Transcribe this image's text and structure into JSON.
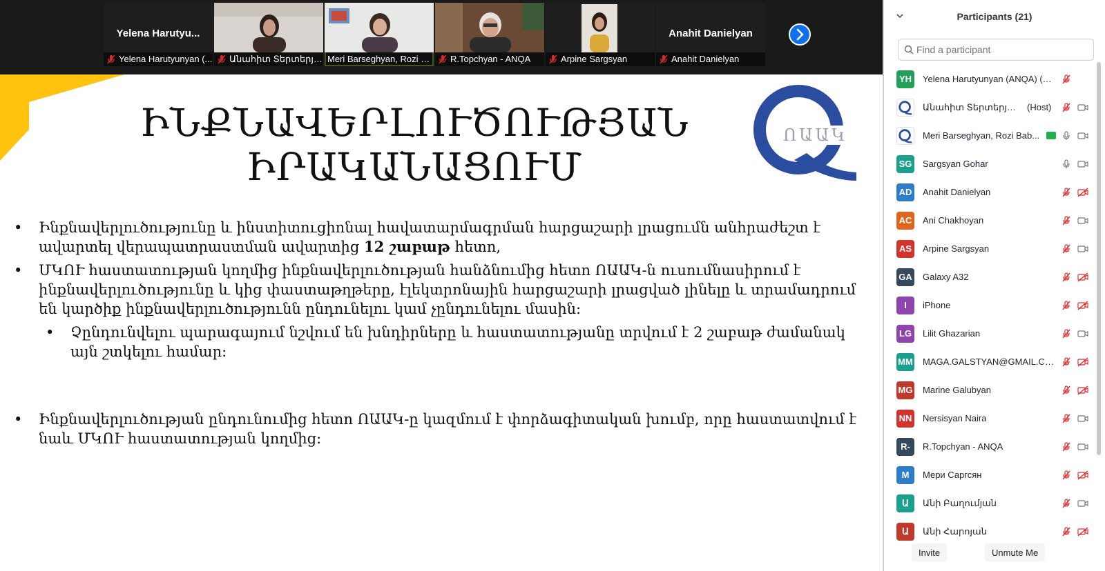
{
  "video_strip": {
    "tiles": [
      {
        "big_name": "Yelena  Harutyu...",
        "caption": "Yelena Harutyunyan (..."
      },
      {
        "caption": "Անահիտ Տերտերյա..."
      },
      {
        "caption": "Meri Barseghyan, Rozi B..."
      },
      {
        "caption": "R.Topchyan - ANQA"
      },
      {
        "caption": "Arpine Sargsyan"
      },
      {
        "big_name": "Anahit Danielyan",
        "caption": "Anahit Danielyan"
      }
    ],
    "next_icon": "chevron-right-icon"
  },
  "slide": {
    "title_line1": "ԻՆՔՆԱՎԵՐԼՈՒԾՈՒԹՅԱՆ",
    "title_line2": "ԻՐԱԿԱՆԱՑՈՒՄ",
    "logo_text": "ՈԱԱԿ",
    "bullet1_part1": "Ինքնավերլուծությունը և ինստիտուցիոնալ հավատարմագրման հարցաշարի լրացումն անհրաժեշտ է ավարտել վերապատրաստման ավարտից",
    "bullet1_bold": "12 շաբաթ",
    "bullet1_part2": "հետո,",
    "bullet2": "ՄԿՈՒ հաստատության կողմից ինքնավերլուծության հանձնումից հետո ՈԱԱԿ-ն ուսումնասիրում է ինքնավերլուծությունը և կից փաստաթղթերը, էլեկտրոնային հարցաշարի լրացված լինելը և տրամադրում են կարծիք ինքնավերլուծությունն ընդունելու կամ չընդունելու մասին:",
    "sub_bullet": "Չընդունվելու պարագայում նշվում են խնդիրները և հաստատությանը տրվում է 2 շաբաթ ժամանակ այն շտկելու համար:",
    "bullet3": "Ինքնավերլուծության ընդունումից հետո ՈԱԱԿ-ը կազմում է փորձագիտական խումբ, որը հաստատվում է նաև ՄԿՈՒ հաստատության կողմից:",
    "bullet_glyph": "•",
    "accent_color": "#FFC20E",
    "logo_color": "#2B4DA0"
  },
  "participants": {
    "title": "Participants (21)",
    "search_placeholder": "Find a participant",
    "items": [
      {
        "initials": "YH",
        "name": "Yelena Harutyunyan (ANQA) (Me)",
        "color": "#23A05A",
        "mic": "muted"
      },
      {
        "initials": "",
        "name": "Անահիտ Տերտերյան/Ո...",
        "tag": "(Host)",
        "color": "#ffffff",
        "logo": true,
        "mic": "muted",
        "video": "on"
      },
      {
        "initials": "",
        "name": "Meri Barseghyan, Rozi Bab...",
        "color": "#ffffff",
        "logo": true,
        "mic": "on",
        "video": "on",
        "sharing": true
      },
      {
        "initials": "SG",
        "name": "Sargsyan Gohar",
        "color": "#1AA08C",
        "mic": "on",
        "video": "on"
      },
      {
        "initials": "AD",
        "name": "Anahit Danielyan",
        "color": "#2D7DC8",
        "mic": "muted",
        "video": "off"
      },
      {
        "initials": "AC",
        "name": "Ani Chakhoyan",
        "color": "#E0651E",
        "mic": "muted",
        "video": "on"
      },
      {
        "initials": "AS",
        "name": "Arpine Sargsyan",
        "color": "#D0342C",
        "mic": "muted",
        "video": "on"
      },
      {
        "initials": "GA",
        "name": "Galaxy A32",
        "color": "#34495E",
        "mic": "muted",
        "video": "off"
      },
      {
        "initials": "I",
        "name": "iPhone",
        "color": "#8E44AD",
        "mic": "muted",
        "video": "off"
      },
      {
        "initials": "LG",
        "name": "Lilit Ghazarian",
        "color": "#8E44AD",
        "mic": "muted",
        "video": "on"
      },
      {
        "initials": "MM",
        "name": "MAGA.GALSTYAN@GMAIL.COM...",
        "color": "#1AA08C",
        "mic": "muted",
        "video": "off"
      },
      {
        "initials": "MG",
        "name": "Marine Galubyan",
        "color": "#C0392B",
        "mic": "muted",
        "video": "off"
      },
      {
        "initials": "NN",
        "name": "Nersisyan Naira",
        "color": "#D0342C",
        "mic": "muted",
        "video": "on"
      },
      {
        "initials": "R-",
        "name": "R.Topchyan - ANQA",
        "color": "#34495E",
        "mic": "muted",
        "video": "on"
      },
      {
        "initials": "M",
        "name": "Мери Саргсян",
        "color": "#2D7DC8",
        "mic": "muted",
        "video": "off"
      },
      {
        "initials": "Ա",
        "name": "Անի Բաղումյան",
        "color": "#1AA08C",
        "mic": "muted",
        "video": "on"
      },
      {
        "initials": "Ա",
        "name": "Անի Հարոյան",
        "color": "#C0392B",
        "mic": "muted",
        "video": "off"
      }
    ],
    "invite_label": "Invite",
    "unmute_label": "Unmute Me"
  }
}
